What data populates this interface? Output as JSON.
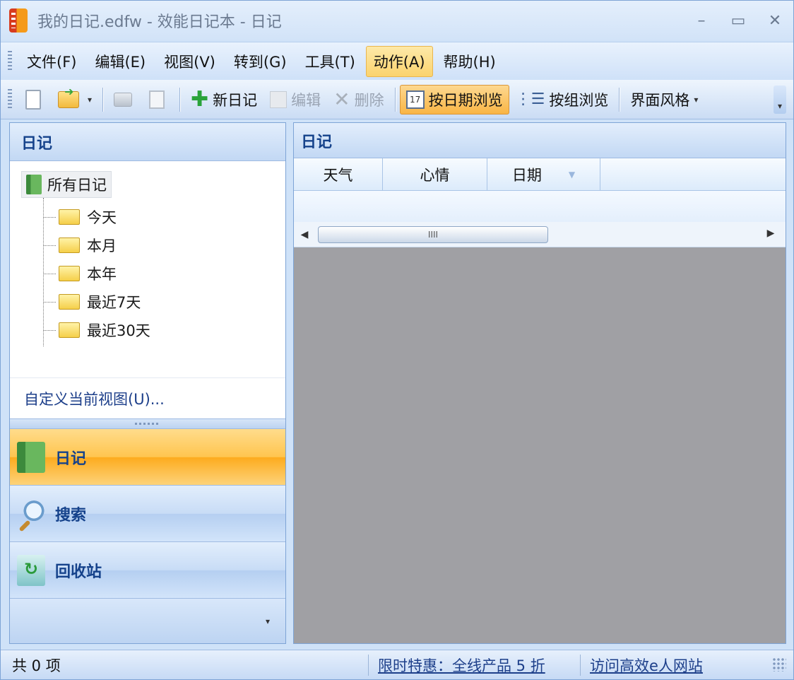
{
  "window": {
    "title": "我的日记.edfw - 效能日记本 - 日记",
    "controls": {
      "minimize": "–",
      "maximize": "▭",
      "close": "✕"
    }
  },
  "menu": [
    "文件(F)",
    "编辑(E)",
    "视图(V)",
    "转到(G)",
    "工具(T)",
    "动作(A)",
    "帮助(H)"
  ],
  "menu_active_index": 5,
  "toolbar": {
    "new_diary": "新日记",
    "edit": "编辑",
    "delete": "删除",
    "browse_by_date": "按日期浏览",
    "browse_by_group": "按组浏览",
    "ui_style": "界面风格",
    "calendar_num": "17"
  },
  "left_panel": {
    "header": "日记",
    "tree_root": "所有日记",
    "tree_items": [
      "今天",
      "本月",
      "本年",
      "最近7天",
      "最近30天"
    ],
    "customize_view": "自定义当前视图(U)..."
  },
  "nav": {
    "diary": "日记",
    "search": "搜索",
    "recycle": "回收站"
  },
  "right_panel": {
    "header": "日记",
    "columns": [
      "天气",
      "心情",
      "日期"
    ],
    "scroll_thumb": "IIII"
  },
  "status": {
    "count": "共 0 项",
    "promo_link": "限时特惠：全线产品 5 折",
    "site_link": "访问高效e人网站"
  },
  "colors": {
    "accent_orange": "#fdab1e",
    "header_blue": "#15428b",
    "link_blue": "#1d3f8a",
    "content_gray": "#a0a0a4"
  }
}
